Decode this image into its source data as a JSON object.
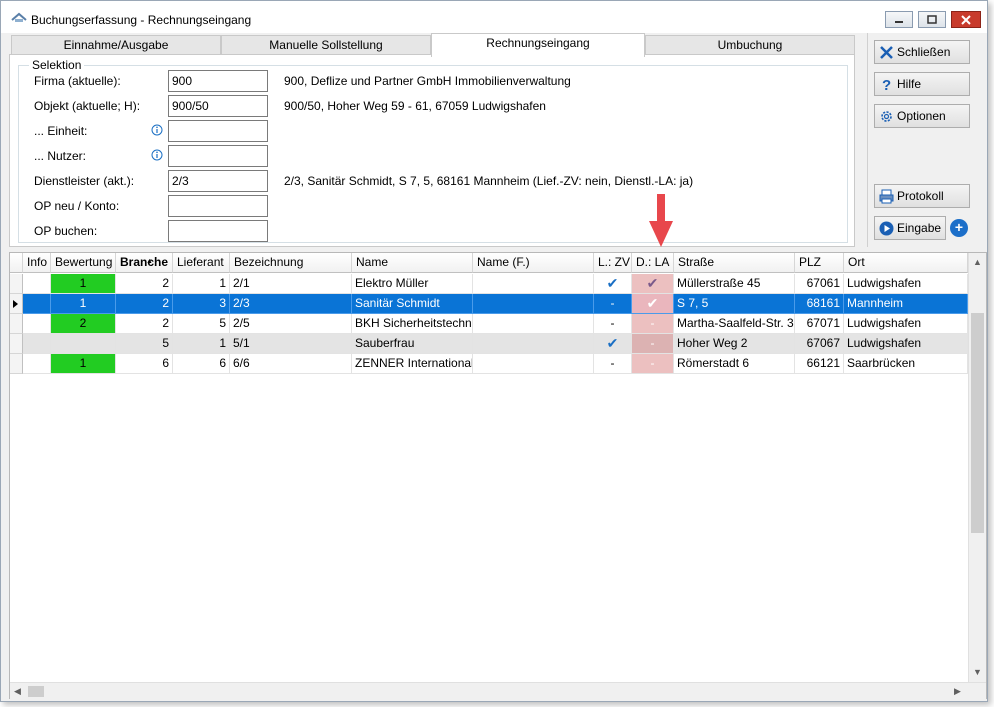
{
  "window": {
    "title": "Buchungserfassung - Rechnungseingang"
  },
  "tabs": [
    {
      "label": "Einnahme/Ausgabe"
    },
    {
      "label": "Manuelle Sollstellung"
    },
    {
      "label": "Rechnungseingang"
    },
    {
      "label": "Umbuchung"
    }
  ],
  "selection": {
    "legend": "Selektion",
    "fields": [
      {
        "label": "Firma (aktuelle):",
        "value": "900",
        "desc": "900,  Deflize und Partner GmbH Immobilienverwaltung"
      },
      {
        "label": "Objekt (aktuelle; H):",
        "value": "900/50",
        "desc": "900/50,  Hoher Weg 59 - 61, 67059 Ludwigshafen"
      },
      {
        "label": "... Einheit:",
        "value": "",
        "desc": ""
      },
      {
        "label": "... Nutzer:",
        "value": "",
        "desc": ""
      },
      {
        "label": "Dienstleister (akt.):",
        "value": "2/3",
        "desc": "2/3,  Sanitär Schmidt,  S 7, 5, 68161 Mannheim  (Lief.-ZV: nein,  Dienstl.-LA: ja)"
      },
      {
        "label": "OP neu / Konto:",
        "value": "",
        "desc": ""
      },
      {
        "label": "OP buchen:",
        "value": "",
        "desc": ""
      }
    ]
  },
  "side_buttons": {
    "close": "Schließen",
    "help": "Hilfe",
    "options": "Optionen",
    "protocol": "Protokoll",
    "entry": "Eingabe"
  },
  "grid": {
    "columns": [
      "Info",
      "Bewertung",
      "Branche",
      "Lieferant",
      "Bezeichnung",
      "Name",
      "Name (F.)",
      "L.: ZV",
      "D.: LA",
      "Straße",
      "PLZ",
      "Ort"
    ],
    "rows": [
      {
        "info": "",
        "bewertung": "1",
        "branche": "2",
        "lieferant": "1",
        "bezeichnung": "2/1",
        "name": "Elektro Müller",
        "name_f": "",
        "lzv": "✔",
        "dla": "✔",
        "strasse": "Müllerstraße 45",
        "plz": "67061",
        "ort": "Ludwigshafen"
      },
      {
        "info": "",
        "bewertung": "1",
        "branche": "2",
        "lieferant": "3",
        "bezeichnung": "2/3",
        "name": "Sanitär Schmidt",
        "name_f": "",
        "lzv": "-",
        "dla": "✔",
        "strasse": "S 7, 5",
        "plz": "68161",
        "ort": "Mannheim"
      },
      {
        "info": "",
        "bewertung": "2",
        "branche": "2",
        "lieferant": "5",
        "bezeichnung": "2/5",
        "name": "BKH Sicherheitstechni",
        "name_f": "",
        "lzv": "-",
        "dla": "-",
        "strasse": "Martha-Saalfeld-Str. 3",
        "plz": "67071",
        "ort": "Ludwigshafen"
      },
      {
        "info": "",
        "bewertung": "",
        "branche": "5",
        "lieferant": "1",
        "bezeichnung": "5/1",
        "name": "Sauberfrau",
        "name_f": "",
        "lzv": "✔",
        "dla": "-",
        "strasse": "Hoher Weg 2",
        "plz": "67067",
        "ort": "Ludwigshafen"
      },
      {
        "info": "",
        "bewertung": "1",
        "branche": "6",
        "lieferant": "6",
        "bezeichnung": "6/6",
        "name": "ZENNER International",
        "name_f": "",
        "lzv": "-",
        "dla": "-",
        "strasse": "Römerstadt 6",
        "plz": "66121",
        "ort": "Saarbrücken"
      }
    ]
  },
  "colors": {
    "selected_row": "#0a74d6",
    "rating_green": "#22cc22",
    "highlight_column": "#ecc0c0",
    "arrow": "#e8474c",
    "check_blue": "#1a6fc4"
  }
}
